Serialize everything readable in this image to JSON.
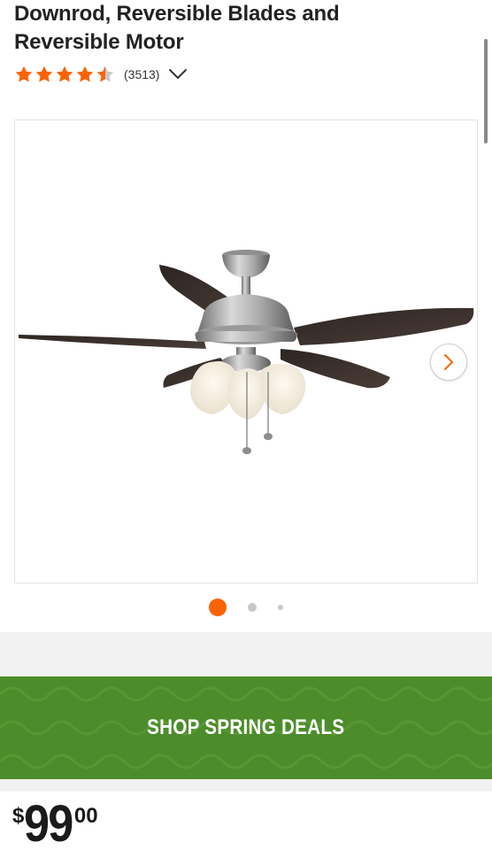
{
  "product": {
    "title_line1": "Downrod, Reversible Blades and",
    "title_line2": "Reversible Motor",
    "rating": 4.5,
    "rating_max": 5,
    "review_count": "(3513)"
  },
  "gallery": {
    "image_alt": "Ceiling fan with brushed nickel finish, dark reversible blades and frosted glass light kit",
    "images_total": 3,
    "active_index": 0
  },
  "promo": {
    "label": "SHOP SPRING DEALS"
  },
  "price": {
    "symbol": "$",
    "dollars": "99",
    "cents": "00"
  },
  "colors": {
    "brand_orange": "#f96302",
    "promo_green": "#4c8c2b",
    "star_empty": "#c8c8c8"
  },
  "icons": {
    "review_toggle": "chevron-down-icon",
    "gallery_next": "chevron-right-icon",
    "rating": "star-icon"
  }
}
